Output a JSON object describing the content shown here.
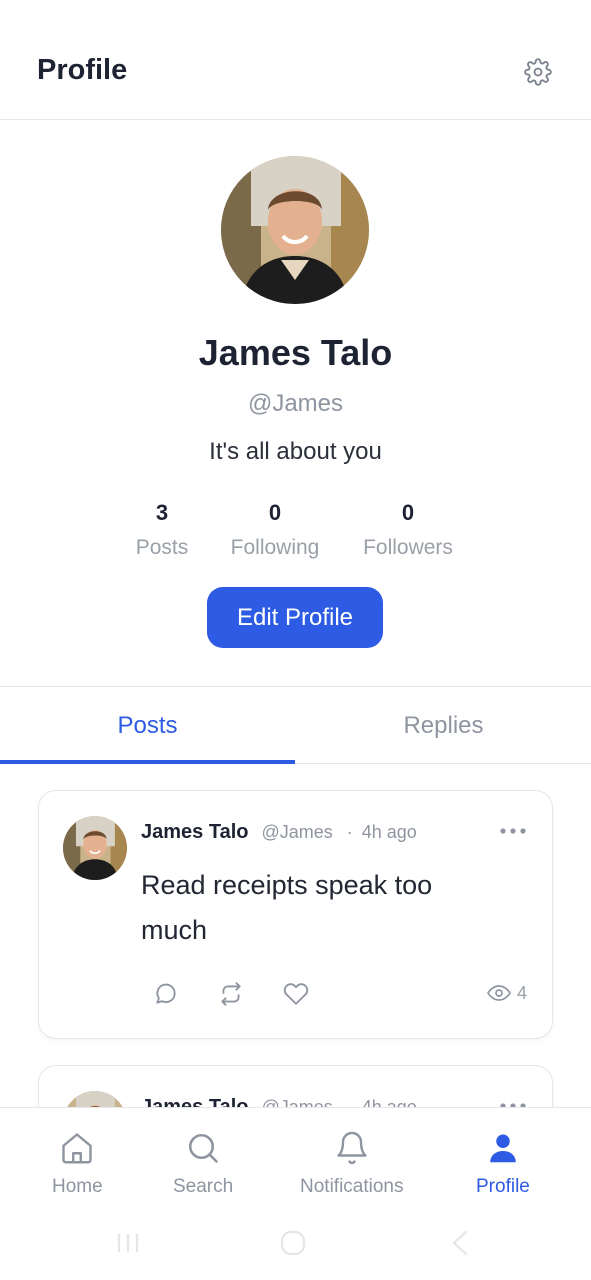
{
  "header": {
    "title": "Profile",
    "settings_icon": "gear-icon"
  },
  "profile": {
    "name": "James Talo",
    "handle": "@James",
    "bio": "It's all about you",
    "stats": [
      {
        "value": "3",
        "label": "Posts"
      },
      {
        "value": "0",
        "label": "Following"
      },
      {
        "value": "0",
        "label": "Followers"
      }
    ],
    "edit_button": "Edit Profile"
  },
  "tabs": [
    {
      "label": "Posts",
      "active": true
    },
    {
      "label": "Replies",
      "active": false
    }
  ],
  "posts": [
    {
      "author": "James Talo",
      "handle": "@James",
      "separator": "·",
      "time": "4h ago",
      "text": "Read receipts speak too much",
      "views": "4"
    },
    {
      "author": "James Talo",
      "handle": "@James",
      "separator": "·",
      "time": "4h ago"
    }
  ],
  "bottom_nav": [
    {
      "label": "Home",
      "icon": "home-icon",
      "active": false
    },
    {
      "label": "Search",
      "icon": "search-icon",
      "active": false
    },
    {
      "label": "Notifications",
      "icon": "bell-icon",
      "active": false
    },
    {
      "label": "Profile",
      "icon": "user-icon",
      "active": true
    }
  ],
  "colors": {
    "accent": "#2d5be3",
    "muted": "#8f95a0",
    "text": "#1e2333",
    "border": "#e6e8ec"
  }
}
